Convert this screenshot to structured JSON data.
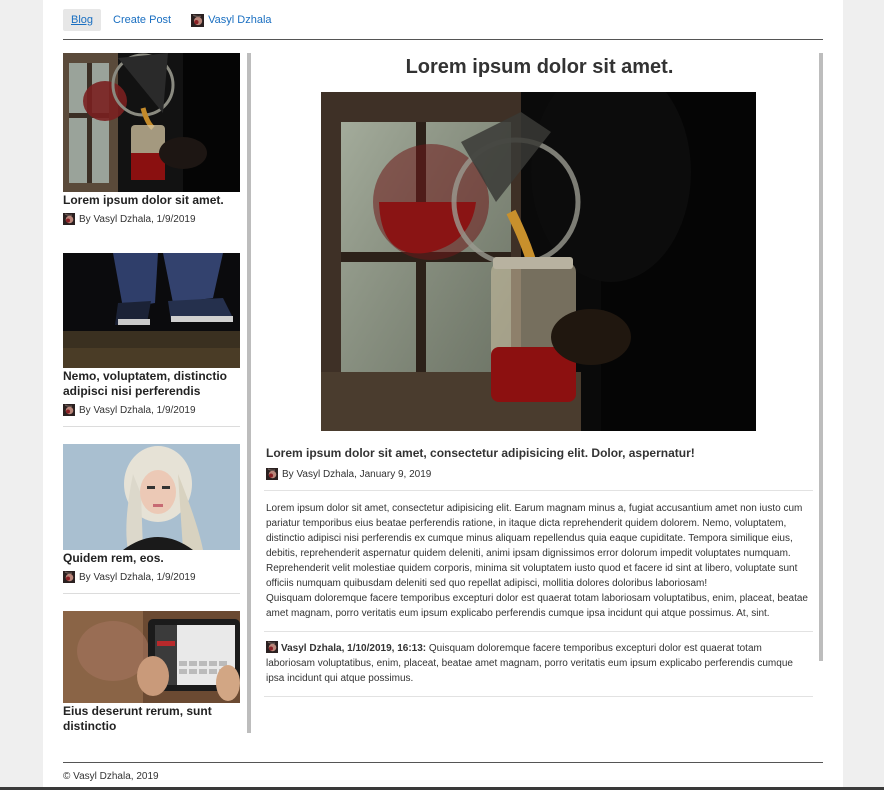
{
  "nav": {
    "blog": "Blog",
    "create_post": "Create Post",
    "user": "Vasyl Dzhala"
  },
  "sidebar": {
    "posts": [
      {
        "title": "Lorem ipsum dolor sit amet.",
        "meta": "By Vasyl Dzhala, 1/9/2019",
        "image": "pouring-tea-photo"
      },
      {
        "title": "Nemo, voluptatem, distinctio adipisci nisi perferendis",
        "meta": "By Vasyl Dzhala, 1/9/2019",
        "image": "sneakers-photo"
      },
      {
        "title": "Quidem rem, eos.",
        "meta": "By Vasyl Dzhala, 1/9/2019",
        "image": "blonde-woman-photo"
      },
      {
        "title": "Eius deserunt rerum, sunt distinctio",
        "meta": "",
        "image": "tablet-photo"
      }
    ]
  },
  "article": {
    "title": "Lorem ipsum dolor sit amet.",
    "lead": "Lorem ipsum dolor sit amet, consectetur adipisicing elit. Dolor, aspernatur!",
    "meta": "By Vasyl Dzhala, January 9, 2019",
    "paragraphs": [
      "Lorem ipsum dolor sit amet, consectetur adipisicing elit. Earum magnam minus a, fugiat accusantium amet non iusto cum pariatur temporibus eius beatae perferendis ratione, in itaque dicta reprehenderit quidem dolorem. Nemo, voluptatem, distinctio adipisci nisi perferendis ex cumque minus aliquam repellendus quia eaque cupiditate. Tempora similique eius, debitis, reprehenderit aspernatur quidem deleniti, animi ipsam dignissimos error dolorum impedit voluptates numquam.",
      "Reprehenderit velit molestiae quidem corporis, minima sit voluptatem iusto quod et facere id sint at libero, voluptate sunt officiis numquam quibusdam deleniti sed quo repellat adipisci, mollitia dolores doloribus laboriosam!",
      "Quisquam doloremque facere temporibus excepturi dolor est quaerat totam laboriosam voluptatibus, enim, placeat, beatae amet magnam, porro veritatis eum ipsum explicabo perferendis cumque ipsa incidunt qui atque possimus. At, sint."
    ],
    "comment": {
      "author": "Vasyl Dzhala, 1/10/2019, 16:13:",
      "text": "Quisquam doloremque facere temporibus excepturi dolor est quaerat totam laboriosam voluptatibus, enim, placeat, beatae amet magnam, porro veritatis eum ipsum explicabo perferendis cumque ipsa incidunt qui atque possimus."
    }
  },
  "footer": {
    "text": "© Vasyl Dzhala, 2019"
  },
  "colors": {
    "link": "#1a6fc1",
    "rule": "#555555",
    "scrollbar": "#bdbdbd"
  }
}
